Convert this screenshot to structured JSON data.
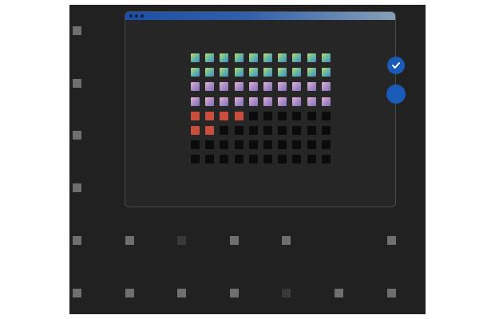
{
  "canvas": {
    "background_color": "#212121",
    "marker_color": "#6f6f6f",
    "marker_dim_color": "#393939"
  },
  "window": {
    "titlebar_color": "#1c4fa8",
    "window_dots": 3
  },
  "progress_grid": {
    "columns": 10,
    "rows": 8,
    "total_cells": 80,
    "colored_cells": 46,
    "fraction_filled": 0.575,
    "row_states": [
      [
        "teal",
        "teal",
        "teal",
        "teal",
        "teal",
        "teal",
        "teal",
        "teal",
        "teal",
        "teal"
      ],
      [
        "teal",
        "teal",
        "teal",
        "teal",
        "teal",
        "teal",
        "teal",
        "teal",
        "teal",
        "teal"
      ],
      [
        "purple",
        "purple",
        "purple",
        "purple",
        "purple",
        "purple",
        "purple",
        "purple",
        "purple",
        "purple"
      ],
      [
        "purple",
        "purple",
        "purple",
        "purple",
        "purple",
        "purple",
        "purple",
        "purple",
        "purple",
        "purple"
      ],
      [
        "red",
        "red",
        "red",
        "red",
        "black",
        "black",
        "black",
        "black",
        "black",
        "black"
      ],
      [
        "red",
        "red",
        "black",
        "black",
        "black",
        "black",
        "black",
        "black",
        "black",
        "black"
      ],
      [
        "black",
        "black",
        "black",
        "black",
        "black",
        "black",
        "black",
        "black",
        "black",
        "black"
      ],
      [
        "black",
        "black",
        "black",
        "black",
        "black",
        "black",
        "black",
        "black",
        "black",
        "black"
      ]
    ],
    "colors": {
      "teal": "#63b9a2",
      "purple": "#a58ac6",
      "red": "#c94e3e",
      "black": "#0b0b0b"
    }
  },
  "controls": {
    "check_button": {
      "icon": "check-icon",
      "color": "#1a5bb8",
      "checked": true
    },
    "circle_button": {
      "icon": "circle-icon",
      "color": "#1a5bb8"
    }
  }
}
